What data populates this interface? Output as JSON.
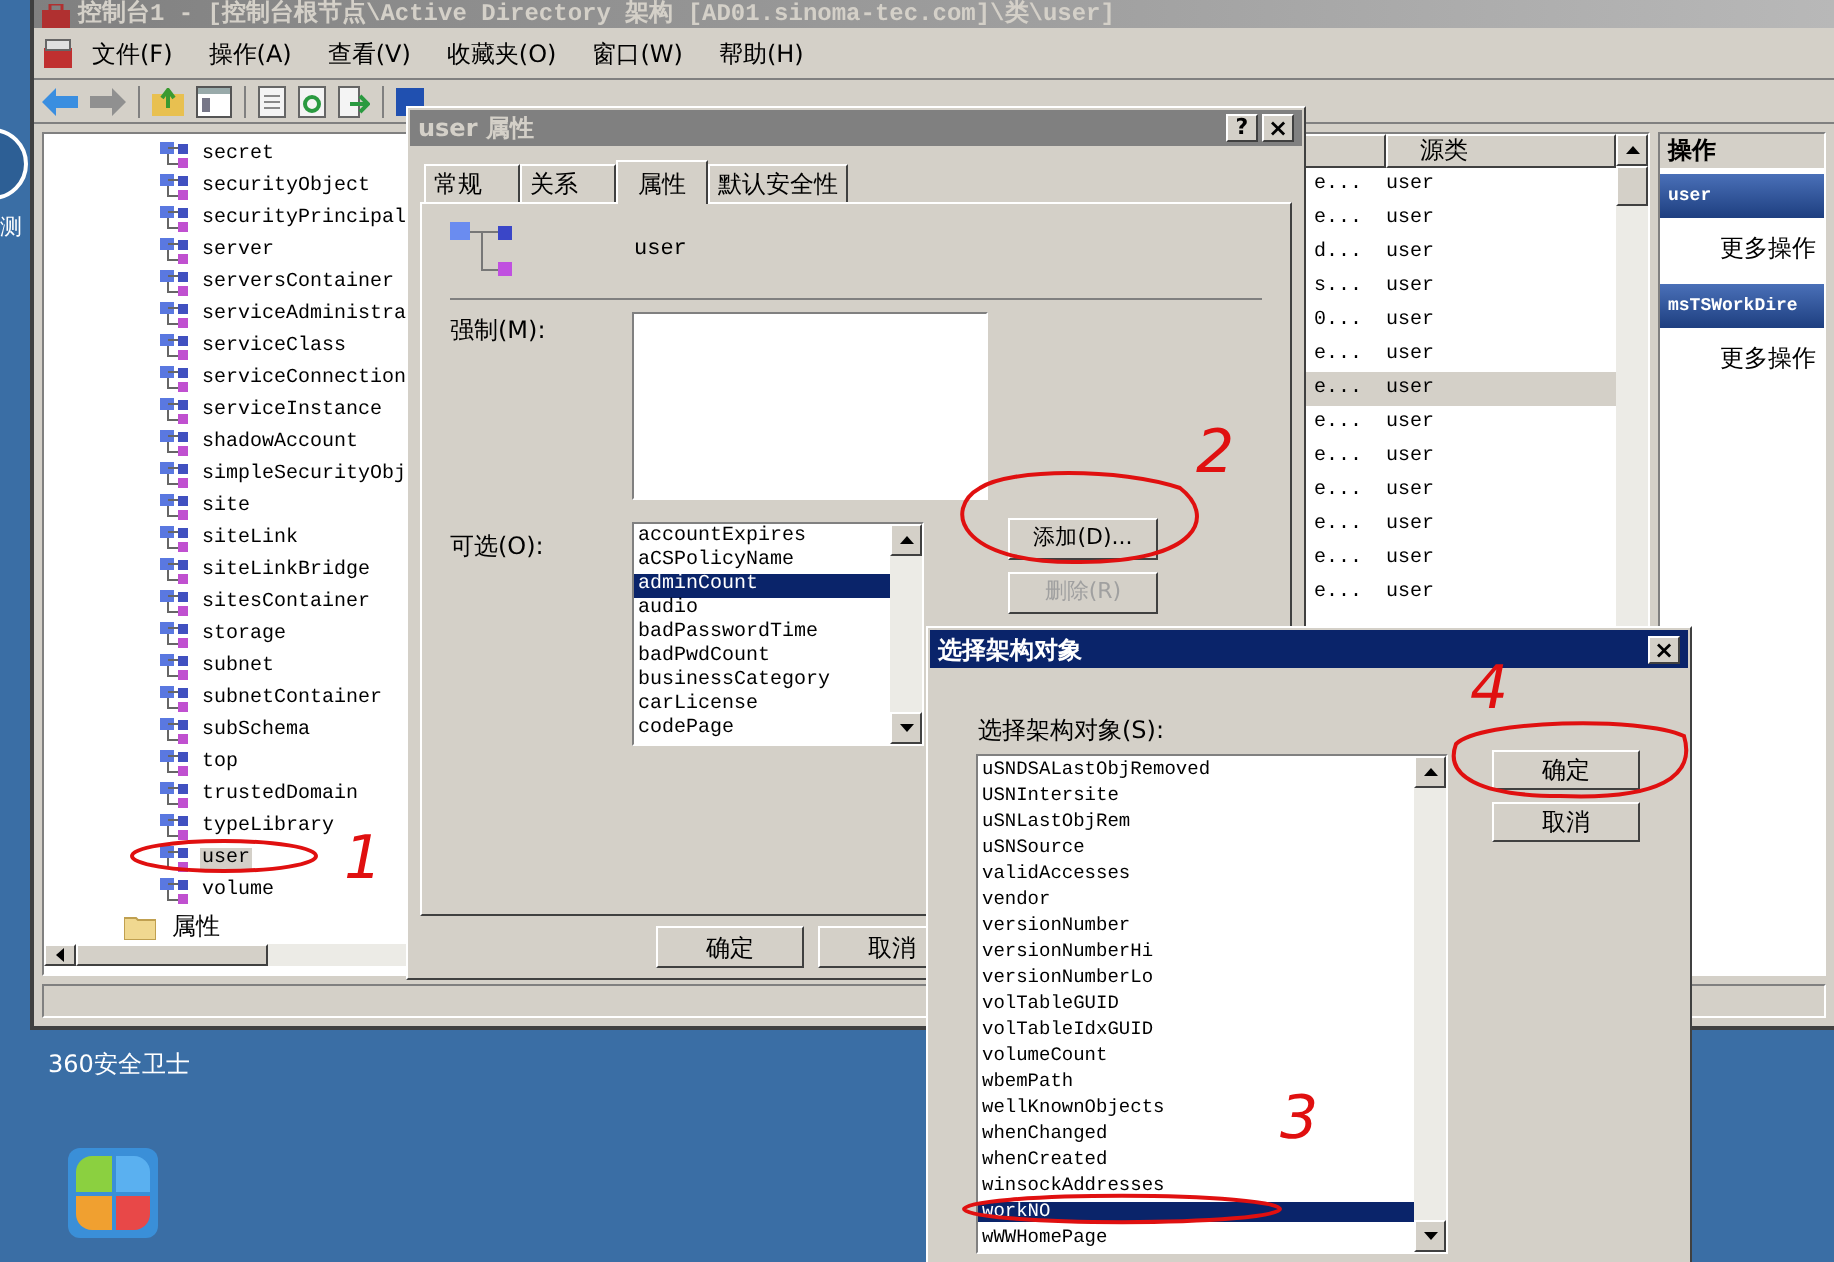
{
  "desktop": {
    "partial_icon_label": "测",
    "icons": [
      {
        "label": "360安全卫士"
      }
    ]
  },
  "mmc": {
    "title": "控制台1 - [控制台根节点\\Active Directory 架构 [AD01.sinoma-tec.com]\\类\\user]",
    "menu": [
      "文件(F)",
      "操作(A)",
      "查看(V)",
      "收藏夹(O)",
      "窗口(W)",
      "帮助(H)"
    ],
    "tree": {
      "items": [
        {
          "label": "secret",
          "selected": false
        },
        {
          "label": "securityObject",
          "selected": false
        },
        {
          "label": "securityPrincipal",
          "selected": false
        },
        {
          "label": "server",
          "selected": false
        },
        {
          "label": "serversContainer",
          "selected": false
        },
        {
          "label": "serviceAdministra",
          "selected": false
        },
        {
          "label": "serviceClass",
          "selected": false
        },
        {
          "label": "serviceConnection",
          "selected": false
        },
        {
          "label": "serviceInstance",
          "selected": false
        },
        {
          "label": "shadowAccount",
          "selected": false
        },
        {
          "label": "simpleSecurityObj",
          "selected": false
        },
        {
          "label": "site",
          "selected": false
        },
        {
          "label": "siteLink",
          "selected": false
        },
        {
          "label": "siteLinkBridge",
          "selected": false
        },
        {
          "label": "sitesContainer",
          "selected": false
        },
        {
          "label": "storage",
          "selected": false
        },
        {
          "label": "subnet",
          "selected": false
        },
        {
          "label": "subnetContainer",
          "selected": false
        },
        {
          "label": "subSchema",
          "selected": false
        },
        {
          "label": "top",
          "selected": false
        },
        {
          "label": "trustedDomain",
          "selected": false
        },
        {
          "label": "typeLibrary",
          "selected": false
        },
        {
          "label": "user",
          "selected": true
        },
        {
          "label": "volume",
          "selected": false
        }
      ],
      "folder": "属性"
    },
    "list": {
      "columns": [
        "源类"
      ],
      "rows": [
        {
          "column_1": "e...",
          "source_class": "user",
          "selected": false
        },
        {
          "column_1": "e...",
          "source_class": "user",
          "selected": false
        },
        {
          "column_1": "d...",
          "source_class": "user",
          "selected": false
        },
        {
          "column_1": "s...",
          "source_class": "user",
          "selected": false
        },
        {
          "column_1": "0...",
          "source_class": "user",
          "selected": false
        },
        {
          "column_1": "e...",
          "source_class": "user",
          "selected": false
        },
        {
          "column_1": "e...",
          "source_class": "user",
          "selected": true
        },
        {
          "column_1": "e...",
          "source_class": "user",
          "selected": false
        },
        {
          "column_1": "e...",
          "source_class": "user",
          "selected": false
        },
        {
          "column_1": "e...",
          "source_class": "user",
          "selected": false
        },
        {
          "column_1": "e...",
          "source_class": "user",
          "selected": false
        },
        {
          "column_1": "e...",
          "source_class": "user",
          "selected": false
        },
        {
          "column_1": "e...",
          "source_class": "user",
          "selected": false
        }
      ]
    },
    "actions": {
      "header": "操作",
      "sections": [
        {
          "title": "user",
          "items": [
            "更多操作"
          ]
        },
        {
          "title": "msTSWorkDire",
          "items": [
            "更多操作"
          ]
        }
      ]
    }
  },
  "properties_dialog": {
    "title": "user 属性",
    "help": "?",
    "close": "×",
    "tabs": [
      {
        "label": "常规",
        "selected": false
      },
      {
        "label": "关系",
        "selected": false
      },
      {
        "label": "属性",
        "selected": true
      },
      {
        "label": "默认安全性",
        "selected": false
      }
    ],
    "class_name": "user",
    "mandatory_label": "强制(M):",
    "optional_label": "可选(O):",
    "optional_items": [
      {
        "label": "accountExpires",
        "selected": false
      },
      {
        "label": "aCSPolicyName",
        "selected": false
      },
      {
        "label": "adminCount",
        "selected": true
      },
      {
        "label": "audio",
        "selected": false
      },
      {
        "label": "badPasswordTime",
        "selected": false
      },
      {
        "label": "badPwdCount",
        "selected": false
      },
      {
        "label": "businessCategory",
        "selected": false
      },
      {
        "label": "carLicense",
        "selected": false
      },
      {
        "label": "codePage",
        "selected": false
      }
    ],
    "side_buttons": [
      {
        "label": "添加(D)...",
        "disabled": false
      },
      {
        "label": "删除(R)",
        "disabled": true
      }
    ],
    "footer_buttons": [
      "确定",
      "取消"
    ]
  },
  "select_dialog": {
    "title": "选择架构对象",
    "close": "×",
    "list_label": "选择架构对象(S):",
    "items": [
      {
        "label": "uSNDSALastObjRemoved",
        "selected": false
      },
      {
        "label": "USNIntersite",
        "selected": false
      },
      {
        "label": "uSNLastObjRem",
        "selected": false
      },
      {
        "label": "uSNSource",
        "selected": false
      },
      {
        "label": "validAccesses",
        "selected": false
      },
      {
        "label": "vendor",
        "selected": false
      },
      {
        "label": "versionNumber",
        "selected": false
      },
      {
        "label": "versionNumberHi",
        "selected": false
      },
      {
        "label": "versionNumberLo",
        "selected": false
      },
      {
        "label": "volTableGUID",
        "selected": false
      },
      {
        "label": "volTableIdxGUID",
        "selected": false
      },
      {
        "label": "volumeCount",
        "selected": false
      },
      {
        "label": "wbemPath",
        "selected": false
      },
      {
        "label": "wellKnownObjects",
        "selected": false
      },
      {
        "label": "whenChanged",
        "selected": false
      },
      {
        "label": "whenCreated",
        "selected": false
      },
      {
        "label": "winsockAddresses",
        "selected": false
      },
      {
        "label": "workNO",
        "selected": true
      },
      {
        "label": "wWWHomePage",
        "selected": false
      }
    ],
    "buttons": [
      "确定",
      "取消"
    ]
  },
  "annotations": [
    {
      "label": "1"
    },
    {
      "label": "2"
    },
    {
      "label": "3"
    },
    {
      "label": "4"
    }
  ]
}
